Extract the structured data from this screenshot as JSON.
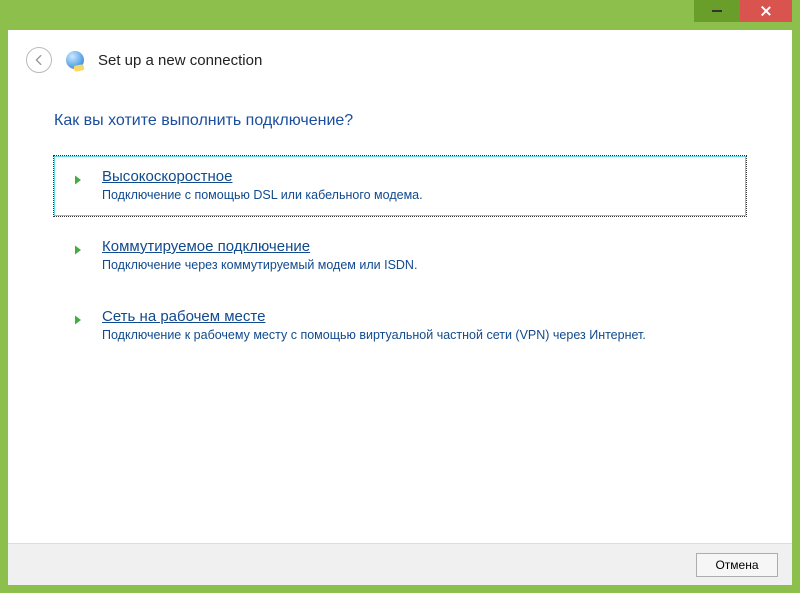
{
  "window": {
    "title": "Set up a new connection"
  },
  "main": {
    "question": "Как вы хотите выполнить подключение?",
    "options": [
      {
        "title": "Высокоскоростное",
        "description": "Подключение с помощью DSL или кабельного модема.",
        "selected": true
      },
      {
        "title": "Коммутируемое подключение",
        "description": "Подключение через коммутируемый модем или ISDN.",
        "selected": false
      },
      {
        "title": "Сеть на рабочем месте",
        "description": "Подключение к рабочему месту с помощью виртуальной частной сети (VPN) через Интернет.",
        "selected": false
      }
    ]
  },
  "footer": {
    "cancel": "Отмена"
  },
  "colors": {
    "chrome": "#8cbf4c",
    "close": "#d9534f",
    "link": "#114a8e",
    "heading": "#1a4e9e"
  }
}
